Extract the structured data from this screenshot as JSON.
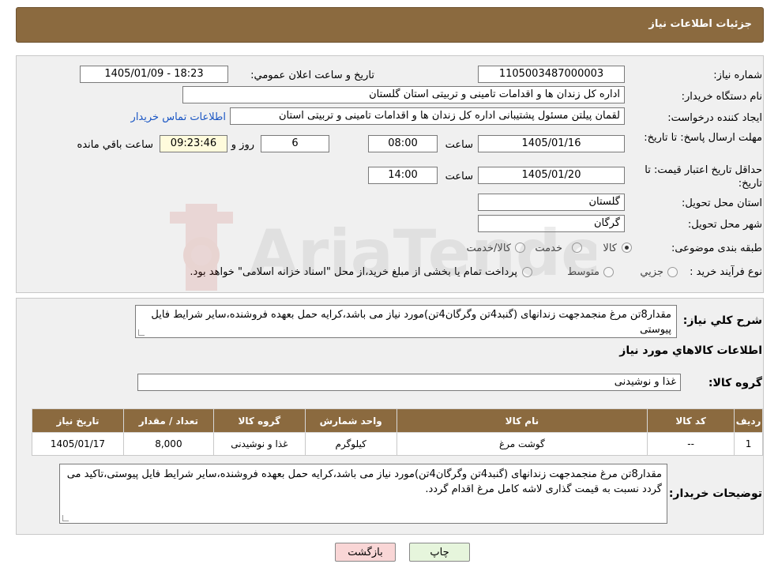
{
  "header": {
    "title": "جزئیات اطلاعات نیاز"
  },
  "form": {
    "need_number_label": "شماره نیاز:",
    "need_number": "1105003487000003",
    "announce_label": "تاریخ و ساعت اعلان عمومي:",
    "announce_value": "1405/01/09 - 18:23",
    "buyer_org_label": "نام دستگاه خريدار:",
    "buyer_org": "اداره کل زندان ها و اقدامات تامینی و تربیتی استان گلستان",
    "requester_label": "ايجاد کننده درخواست:",
    "requester": "لقمان پیلتن مسئول پشتیبانی اداره کل زندان ها و اقدامات تامینی و تربیتی استان",
    "contact_link": "اطلاعات تماس خريدار",
    "reply_deadline_label": "مهلت ارسال پاسخ: تا تاريخ:",
    "reply_date": "1405/01/16",
    "time_label": "ساعت",
    "reply_time": "08:00",
    "days": "6",
    "days_label": "روز و",
    "remaining_time": "09:23:46",
    "remaining_label": "ساعت باقي مانده",
    "price_validity_label": "حداقل تاريخ اعتبار قيمت: تا تاريخ:",
    "price_date": "1405/01/20",
    "price_time": "14:00",
    "province_label": "استان محل تحويل:",
    "province": "گلستان",
    "city_label": "شهر محل تحويل:",
    "city": "گرگان",
    "category_label": "طبقه بندی موضوعی:",
    "category_options": [
      "کالا",
      "خدمت",
      "کالا/خدمت"
    ],
    "purchase_type_label": "نوع فرآيند خريد :",
    "purchase_options": [
      "جزيي",
      "متوسط"
    ],
    "purchase_note": "پرداخت تمام يا بخشی از مبلغ خريد،از محل \"اسناد خزانه اسلامی\" خواهد بود."
  },
  "details": {
    "summary_label": "شرح کلي نياز:",
    "summary": "مقدار8تن مرغ منجمدجهت زندانهای (گنبد4تن وگرگان4تن)مورد نیاز می باشد،کرایه حمل بعهده فروشنده،سایر شرایط فایل پیوستی",
    "goods_info_title": "اطلاعات کالاهاي مورد نياز",
    "goods_group_label": "گروه کالا:",
    "goods_group": "غذا و نوشیدنی",
    "table": {
      "headers": [
        "رديف",
        "کد کالا",
        "نام کالا",
        "واحد شمارش",
        "گروه کالا",
        "تعداد / مقدار",
        "تاريخ نياز"
      ],
      "rows": [
        [
          "1",
          "--",
          "گوشت مرغ",
          "کیلوگرم",
          "غذا و نوشیدنی",
          "8,000",
          "1405/01/17"
        ]
      ]
    },
    "buyer_notes_label": "توضيحات خريدار:",
    "buyer_notes": "مقدار8تن مرغ منجمدجهت زندانهای (گنبد4تن وگرگان4تن)مورد نیاز می باشد،کرایه حمل بعهده فروشنده،سایر شرایط فایل پیوستی،تاکید می گردد نسبت به قیمت گذاری لاشه کامل مرغ اقدام گردد."
  },
  "buttons": {
    "print": "چاپ",
    "back": "بازگشت"
  },
  "watermark": {
    "text": "AriaTender.neT"
  },
  "colors": {
    "header_bg": "#8b6a3f",
    "link": "#1a56c4",
    "back_btn": "#f9d6d6",
    "print_btn": "#e6f5dc"
  }
}
